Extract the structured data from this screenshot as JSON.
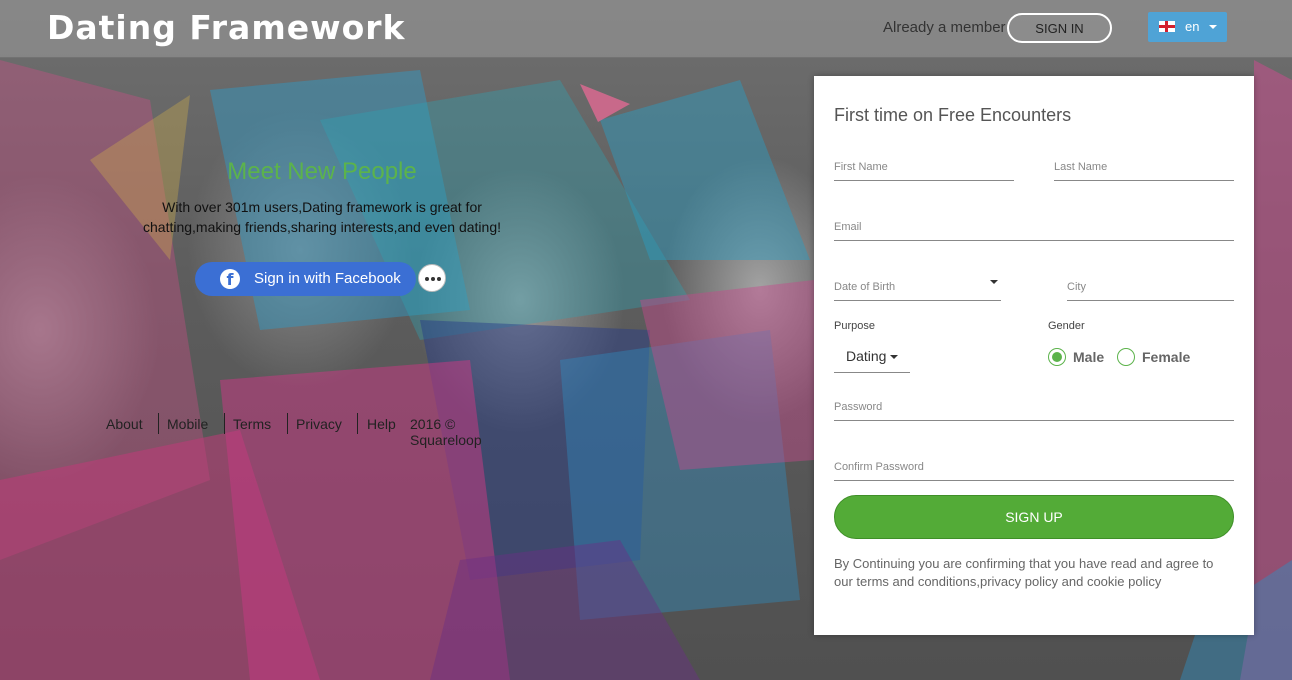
{
  "header": {
    "logo": "Dating Framework",
    "member_text": "Already a member",
    "signin_label": "SIGN IN",
    "language": "en",
    "language_flag_icon": "england-flag-icon"
  },
  "hero": {
    "title": "Meet New People",
    "subtitle": "With over 301m users,Dating framework is great for chatting,making friends,sharing interests,and even dating!",
    "facebook_label": "Sign in with Facebook",
    "facebook_icon": "facebook-icon",
    "more_icon": "more-options-icon"
  },
  "footer": {
    "links": [
      "About",
      "Mobile",
      "Terms",
      "Privacy",
      "Help"
    ],
    "copyright": "2016 © Squareloop"
  },
  "signup": {
    "title": "First time on Free Encounters",
    "first_name_placeholder": "First Name",
    "last_name_placeholder": "Last Name",
    "email_placeholder": "Email",
    "dob_placeholder": "Date of Birth",
    "city_placeholder": "City",
    "purpose_label": "Purpose",
    "purpose_value": "Dating",
    "gender_label": "Gender",
    "gender_options": [
      "Male",
      "Female"
    ],
    "gender_selected": "Male",
    "password_placeholder": "Password",
    "confirm_password_placeholder": "Confirm Password",
    "submit_label": "SIGN UP",
    "terms_prefix": "By Continuing you are confirming that you have read and agree to our ",
    "terms_link": "terms and conditions",
    "privacy_link": "privacy policy",
    "and_text": " and ",
    "cookie_link": "cookie policy"
  },
  "colors": {
    "accent_green": "#5cb34b",
    "button_green": "#53ab37",
    "facebook_blue": "#3b6fd4",
    "language_blue": "#4fa3d6"
  }
}
